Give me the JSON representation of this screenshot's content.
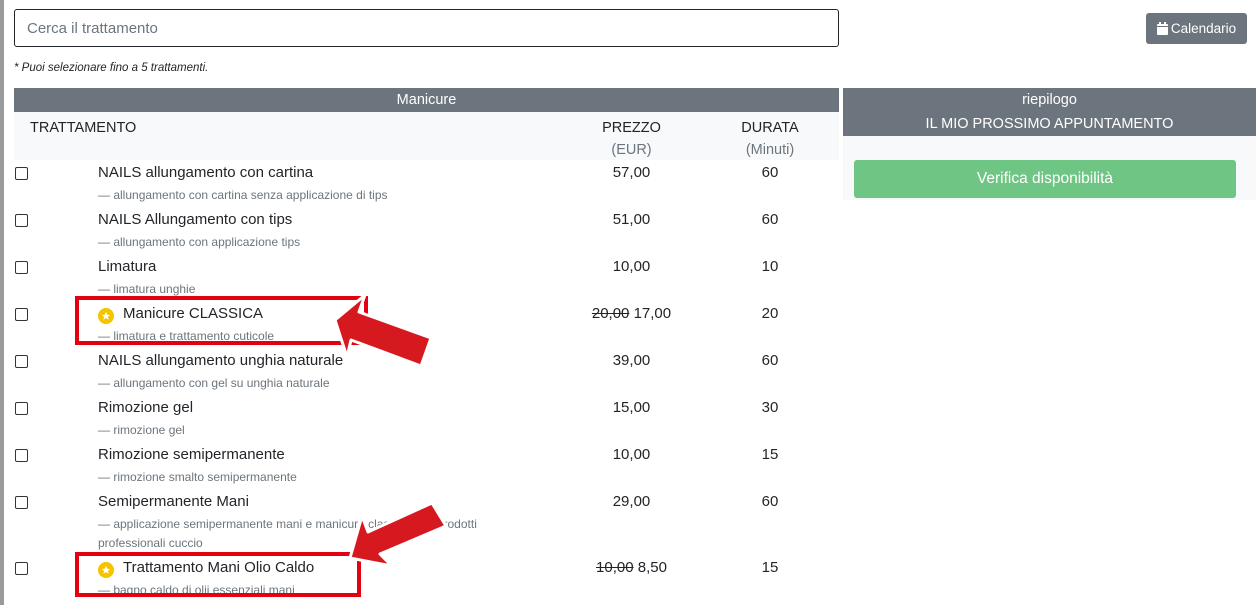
{
  "search": {
    "placeholder": "Cerca il trattamento"
  },
  "calendar_button": {
    "label": "Calendario",
    "icon": "calendar-icon"
  },
  "note": "* Puoi selezionare fino a 5 trattamenti.",
  "category": "Manicure",
  "columns": {
    "treatment": "TRATTAMENTO",
    "price": "PREZZO",
    "price_unit": "(EUR)",
    "duration": "DURATA",
    "duration_unit": "(Minuti)"
  },
  "summary": {
    "line1": "riepilogo",
    "line2": "IL MIO PROSSIMO APPUNTAMENTO",
    "verify_label": "Verifica disponibilità"
  },
  "treatments": [
    {
      "name": "NAILS allungamento con cartina",
      "desc": "— allungamento con cartina senza applicazione di tips",
      "price": "57,00",
      "duration": "60"
    },
    {
      "name": "NAILS Allungamento con tips",
      "desc": "— allungamento con applicazione tips",
      "price": "51,00",
      "duration": "60"
    },
    {
      "name": "Limatura",
      "desc": "— limatura unghie",
      "price": "10,00",
      "duration": "10"
    },
    {
      "name": "Manicure CLASSICA",
      "desc": "— limatura e trattamento cuticole",
      "old_price": "20,00",
      "price": "17,00",
      "duration": "20",
      "starred": true
    },
    {
      "name": "NAILS allungamento unghia naturale",
      "desc": "— allungamento con gel su unghia naturale",
      "price": "39,00",
      "duration": "60"
    },
    {
      "name": "Rimozione gel",
      "desc": "— rimozione gel",
      "price": "15,00",
      "duration": "30"
    },
    {
      "name": "Rimozione semipermanente",
      "desc": "— rimozione smalto semipermanente",
      "price": "10,00",
      "duration": "15"
    },
    {
      "name": "Semipermanente Mani",
      "desc": "— applicazione semipermanente mani e manicure classica con prodotti professionali cuccio",
      "price": "29,00",
      "duration": "60"
    },
    {
      "name": "Trattamento Mani Olio Caldo",
      "desc": "— bagno caldo di olii essenziali mani",
      "old_price": "10,00",
      "price": "8,50",
      "duration": "15",
      "starred": true
    }
  ],
  "colors": {
    "header_bg": "#6c757d",
    "subheader_bg": "#f8f9fa",
    "verify_bg": "#6fc584",
    "star": "#f5c400",
    "annotation": "#e3000f"
  }
}
